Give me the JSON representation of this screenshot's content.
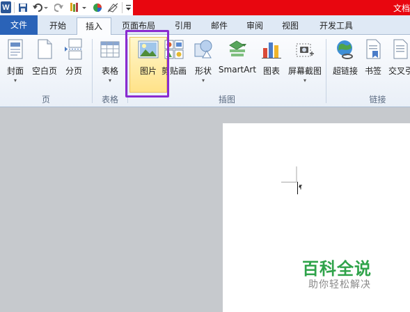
{
  "window": {
    "title_partial": "文档",
    "app_icon": "word-icon"
  },
  "quick_access": [
    "save-icon",
    "undo-icon",
    "redo-icon",
    "format-painter-icon",
    "color-icon",
    "eraser-icon",
    "customize-icon"
  ],
  "tabs": [
    {
      "label": "文件"
    },
    {
      "label": "开始"
    },
    {
      "label": "插入",
      "active": true
    },
    {
      "label": "页面布局"
    },
    {
      "label": "引用"
    },
    {
      "label": "邮件"
    },
    {
      "label": "审阅"
    },
    {
      "label": "视图"
    },
    {
      "label": "开发工具"
    }
  ],
  "groups": {
    "pages": {
      "label": "页",
      "buttons": [
        {
          "label": "封面",
          "icon": "cover-page-icon",
          "has_arrow": true
        },
        {
          "label": "空白页",
          "icon": "blank-page-icon"
        },
        {
          "label": "分页",
          "icon": "page-break-icon"
        }
      ]
    },
    "tables": {
      "label": "表格",
      "buttons": [
        {
          "label": "表格",
          "icon": "table-icon",
          "has_arrow": true
        }
      ]
    },
    "illustrations": {
      "label": "插图",
      "buttons": [
        {
          "label": "图片",
          "icon": "picture-icon",
          "highlighted": true
        },
        {
          "label": "剪贴画",
          "icon": "clip-art-icon"
        },
        {
          "label": "形状",
          "icon": "shapes-icon",
          "has_arrow": true
        },
        {
          "label": "SmartArt",
          "icon": "smartart-icon"
        },
        {
          "label": "图表",
          "icon": "chart-icon"
        },
        {
          "label": "屏幕截图",
          "icon": "screenshot-icon",
          "has_arrow": true
        }
      ]
    },
    "links": {
      "label": "链接",
      "buttons": [
        {
          "label": "超链接",
          "icon": "hyperlink-icon"
        },
        {
          "label": "书签",
          "icon": "bookmark-icon"
        },
        {
          "label": "交叉引用",
          "icon": "cross-reference-icon"
        }
      ]
    }
  },
  "watermark": {
    "title": "百科全说",
    "subtitle": "助你轻松解决"
  },
  "colors": {
    "title_red": "#e8060f",
    "file_tab": "#2a63b8",
    "highlight_box": "#8a2bd0",
    "watermark_green": "#2fa34a"
  }
}
